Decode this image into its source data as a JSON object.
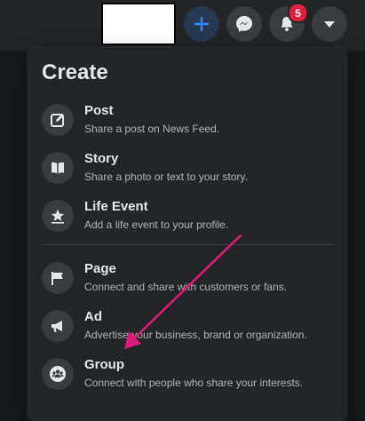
{
  "topbar": {
    "notification_count": "5",
    "buttons": [
      "plus-icon",
      "messenger-icon",
      "bell-icon",
      "caret-down-icon"
    ]
  },
  "menu": {
    "title": "Create",
    "items": [
      {
        "label": "Post",
        "desc": "Share a post on News Feed.",
        "icon": "compose-icon"
      },
      {
        "label": "Story",
        "desc": "Share a photo or text to your story.",
        "icon": "book-icon"
      },
      {
        "label": "Life Event",
        "desc": "Add a life event to your profile.",
        "icon": "star-icon"
      },
      {
        "label": "Page",
        "desc": "Connect and share with customers or fans.",
        "icon": "flag-icon"
      },
      {
        "label": "Ad",
        "desc": "Advertise your business, brand or organization.",
        "icon": "megaphone-icon"
      },
      {
        "label": "Group",
        "desc": "Connect with people who share your interests.",
        "icon": "group-icon"
      }
    ]
  },
  "colors": {
    "accent": "#2d88ff",
    "badge": "#e41e3f",
    "annotation_arrow": "#e0187a"
  }
}
